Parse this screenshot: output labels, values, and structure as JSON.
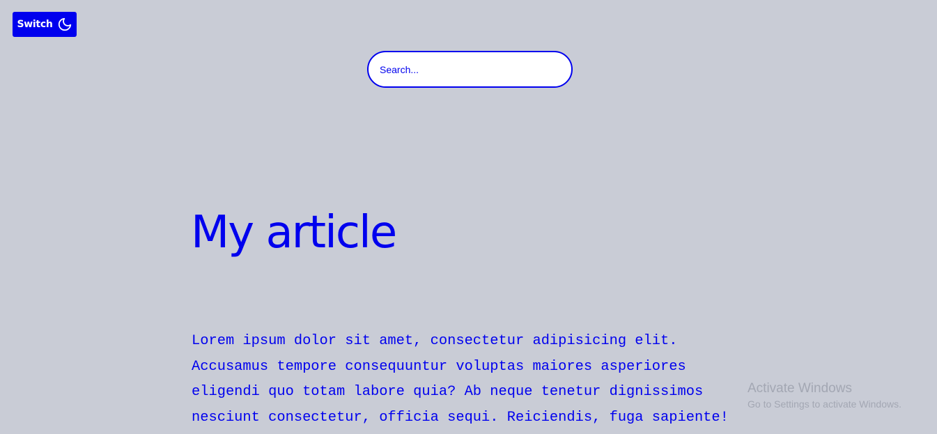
{
  "header": {
    "switch_label": "Switch",
    "switch_icon": "moon-icon"
  },
  "search": {
    "placeholder": "Search..."
  },
  "article": {
    "title": "My article",
    "body": "Lorem ipsum dolor sit amet, consectetur adipisicing elit. Accusamus tempore consequuntur voluptas maiores asperiores eligendi quo totam labore quia? Ab neque tenetur dignissimos nesciunt consectetur, officia sequi. Reiciendis, fuga sapiente!"
  },
  "watermark": {
    "title": "Activate Windows",
    "subtitle": "Go to Settings to activate Windows."
  },
  "colors": {
    "background": "#c9ccd6",
    "accent": "#0000ee",
    "input_background": "#ffffff",
    "watermark": "#a3a7b3"
  }
}
